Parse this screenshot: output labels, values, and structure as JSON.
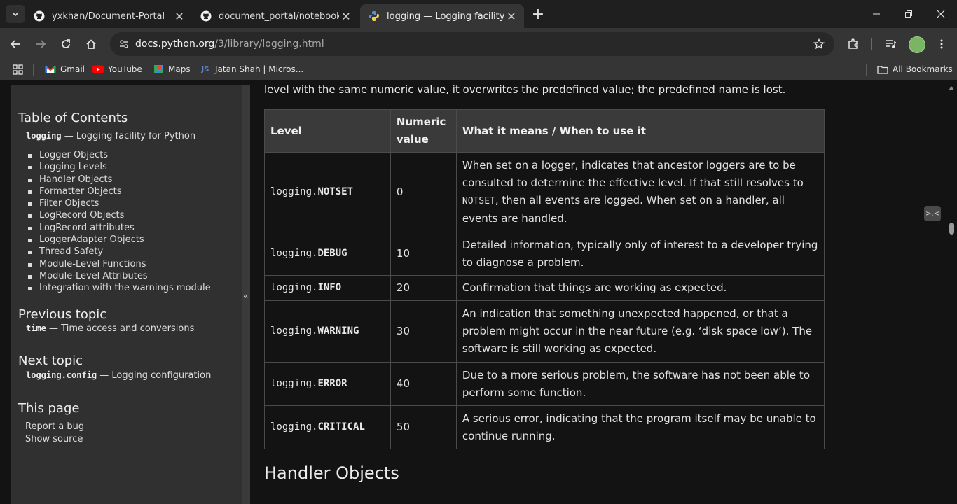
{
  "tabs": [
    {
      "title": "yxkhan/Document-Portal",
      "favicon": "github-icon",
      "active": false
    },
    {
      "title": "document_portal/notebook/lo",
      "favicon": "github-icon",
      "active": false
    },
    {
      "title": "logging — Logging facility for P",
      "favicon": "python-icon",
      "active": true
    }
  ],
  "address": {
    "host": "docs.python.org",
    "path": "/3/library/logging.html"
  },
  "bookmarks": [
    {
      "label": "Gmail",
      "icon": "gmail-icon"
    },
    {
      "label": "YouTube",
      "icon": "youtube-icon"
    },
    {
      "label": "Maps",
      "icon": "maps-icon"
    },
    {
      "label": "Jatan Shah | Micros...",
      "icon": "js-icon"
    }
  ],
  "all_bookmarks": "All Bookmarks",
  "sidebar": {
    "toc_heading": "Table of Contents",
    "toc_root_code": "logging",
    "toc_root_text": " — Logging facility for Python",
    "toc_items": [
      "Logger Objects",
      "Logging Levels",
      "Handler Objects",
      "Formatter Objects",
      "Filter Objects",
      "LogRecord Objects",
      "LogRecord attributes",
      "LoggerAdapter Objects",
      "Thread Safety",
      "Module-Level Functions",
      "Module-Level Attributes",
      "Integration with the warnings module"
    ],
    "prev_heading": "Previous topic",
    "prev_code": "time",
    "prev_text": " — Time access and conversions",
    "next_heading": "Next topic",
    "next_code": "logging.config",
    "next_text": " — Logging configuration",
    "this_page_heading": "This page",
    "report_bug": "Report a bug",
    "show_source": "Show source",
    "collapse": "«"
  },
  "main": {
    "intro": "level with the same numeric value, it overwrites the predefined value; the predefined name is lost.",
    "table": {
      "headers": [
        "Level",
        "Numeric value",
        "What it means / When to use it"
      ],
      "rows": [
        {
          "prefix": "logging.",
          "name": "NOTSET",
          "value": "0",
          "desc_before": "When set on a logger, indicates that ancestor loggers are to be consulted to determine the effective level. If that still resolves to ",
          "desc_code": "NOTSET",
          "desc_after": ", then all events are logged. When set on a handler, all events are handled."
        },
        {
          "prefix": "logging.",
          "name": "DEBUG",
          "value": "10",
          "desc_before": "Detailed information, typically only of interest to a developer trying to diagnose a problem.",
          "desc_code": "",
          "desc_after": ""
        },
        {
          "prefix": "logging.",
          "name": "INFO",
          "value": "20",
          "desc_before": "Confirmation that things are working as expected.",
          "desc_code": "",
          "desc_after": ""
        },
        {
          "prefix": "logging.",
          "name": "WARNING",
          "value": "30",
          "desc_before": "An indication that something unexpected happened, or that a problem might occur in the near future (e.g. ‘disk space low’). The software is still working as expected.",
          "desc_code": "",
          "desc_after": ""
        },
        {
          "prefix": "logging.",
          "name": "ERROR",
          "value": "40",
          "desc_before": "Due to a more serious problem, the software has not been able to perform some function.",
          "desc_code": "",
          "desc_after": ""
        },
        {
          "prefix": "logging.",
          "name": "CRITICAL",
          "value": "50",
          "desc_before": "A serious error, indicating that the program itself may be unable to continue running.",
          "desc_code": "",
          "desc_after": ""
        }
      ]
    },
    "next_section": "Handler Objects"
  },
  "colors": {
    "page_bg": "#131313",
    "sidebar_bg": "#303030",
    "tab_active": "#353535",
    "tabstrip": "#1f1f1f"
  }
}
